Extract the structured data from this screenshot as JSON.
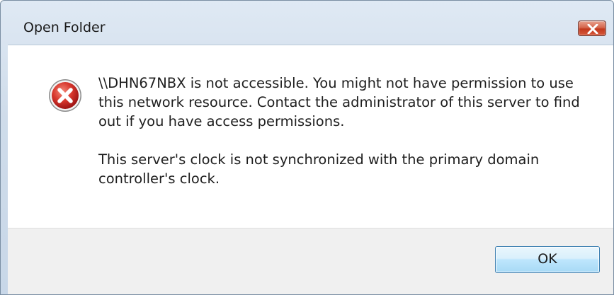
{
  "window": {
    "title": "Open Folder"
  },
  "message": {
    "paragraph1": "\\\\DHN67NBX is not accessible. You might not have permission to use this network resource. Contact the administrator of this server to find out if you have access permissions.",
    "paragraph2": "This server's clock is not synchronized with the primary domain controller's clock."
  },
  "buttons": {
    "ok_label": "OK"
  },
  "icons": {
    "close": "close-icon",
    "error": "error-icon"
  },
  "colors": {
    "close_button": "#c2381d",
    "error_red": "#d22b2b",
    "ok_border": "#3c7fb1"
  }
}
